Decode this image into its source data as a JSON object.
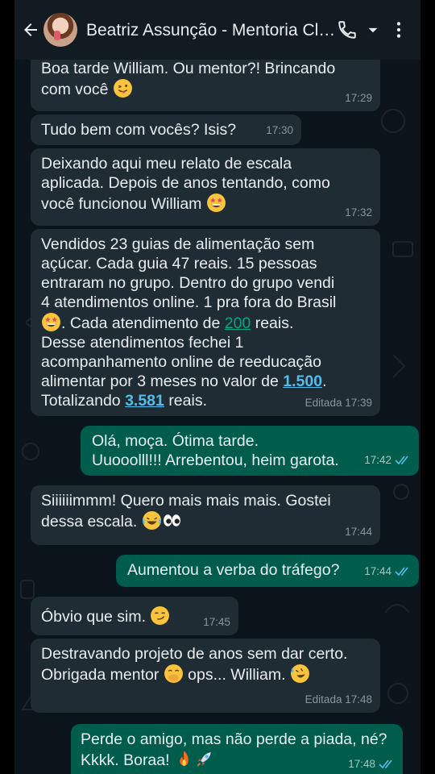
{
  "header": {
    "contact_name": "Beatriz Assunção - Mentoria Cli..."
  },
  "messages": [
    {
      "lines": [
        "Boa tarde William. Ou mentor?! Brincando",
        "com você"
      ],
      "time": "17:29"
    },
    {
      "lines": [
        "Tudo bem com vocês? Isis?"
      ],
      "time": "17:30"
    },
    {
      "lines": [
        "Deixando aqui meu relato de escala",
        "aplicada. Depois de anos tentando, como",
        "você funcionou William"
      ],
      "time": "17:32"
    },
    {
      "lines": [
        "Vendidos 23 guias de alimentação sem",
        "açúcar. Cada guia 47 reais. 15 pessoas",
        "entraram no grupo. Dentro do grupo vendi",
        "4 atendimentos online. 1 pra fora do Brasil",
        ". Cada atendimento de",
        "reais.",
        "Desse atendimentos fechei 1",
        "acompanhamento  online de reeducação",
        "alimentar por 3 meses no valor de",
        ".",
        "Totalizando",
        "reais."
      ],
      "value_200": "200",
      "value_1500": "1.500",
      "value_3581": "3.581",
      "time": "Editada 17:39"
    },
    {
      "lines": [
        "Olá, moça. Ótima tarde.",
        "Uuooolll!!! Arrebentou, heim garota."
      ],
      "time": "17:42"
    },
    {
      "lines": [
        "Siiiiiimmm! Quero mais mais mais. Gostei",
        "dessa escala."
      ],
      "time": "17:44"
    },
    {
      "lines": [
        "Aumentou a verba do tráfego?"
      ],
      "time": "17:44"
    },
    {
      "lines": [
        "Óbvio que sim."
      ],
      "time": "17:45"
    },
    {
      "lines": [
        "Destravando projeto de anos sem dar certo.",
        "Obrigada mentor",
        "ops... William."
      ],
      "time": "Editada 17:48"
    },
    {
      "lines": [
        "Perde o amigo, mas não perde a piada, né?",
        "Kkkk. Boraa!"
      ],
      "time": "17:48"
    }
  ],
  "colors": {
    "incoming_bubble": "#202c33",
    "outgoing_bubble": "#005c4b",
    "background": "#0b141a",
    "read_ticks": "#53bdeb"
  },
  "icons": [
    "back-arrow-icon",
    "phone-icon",
    "dropdown-arrow-icon",
    "more-vertical-icon",
    "double-check-icon"
  ]
}
